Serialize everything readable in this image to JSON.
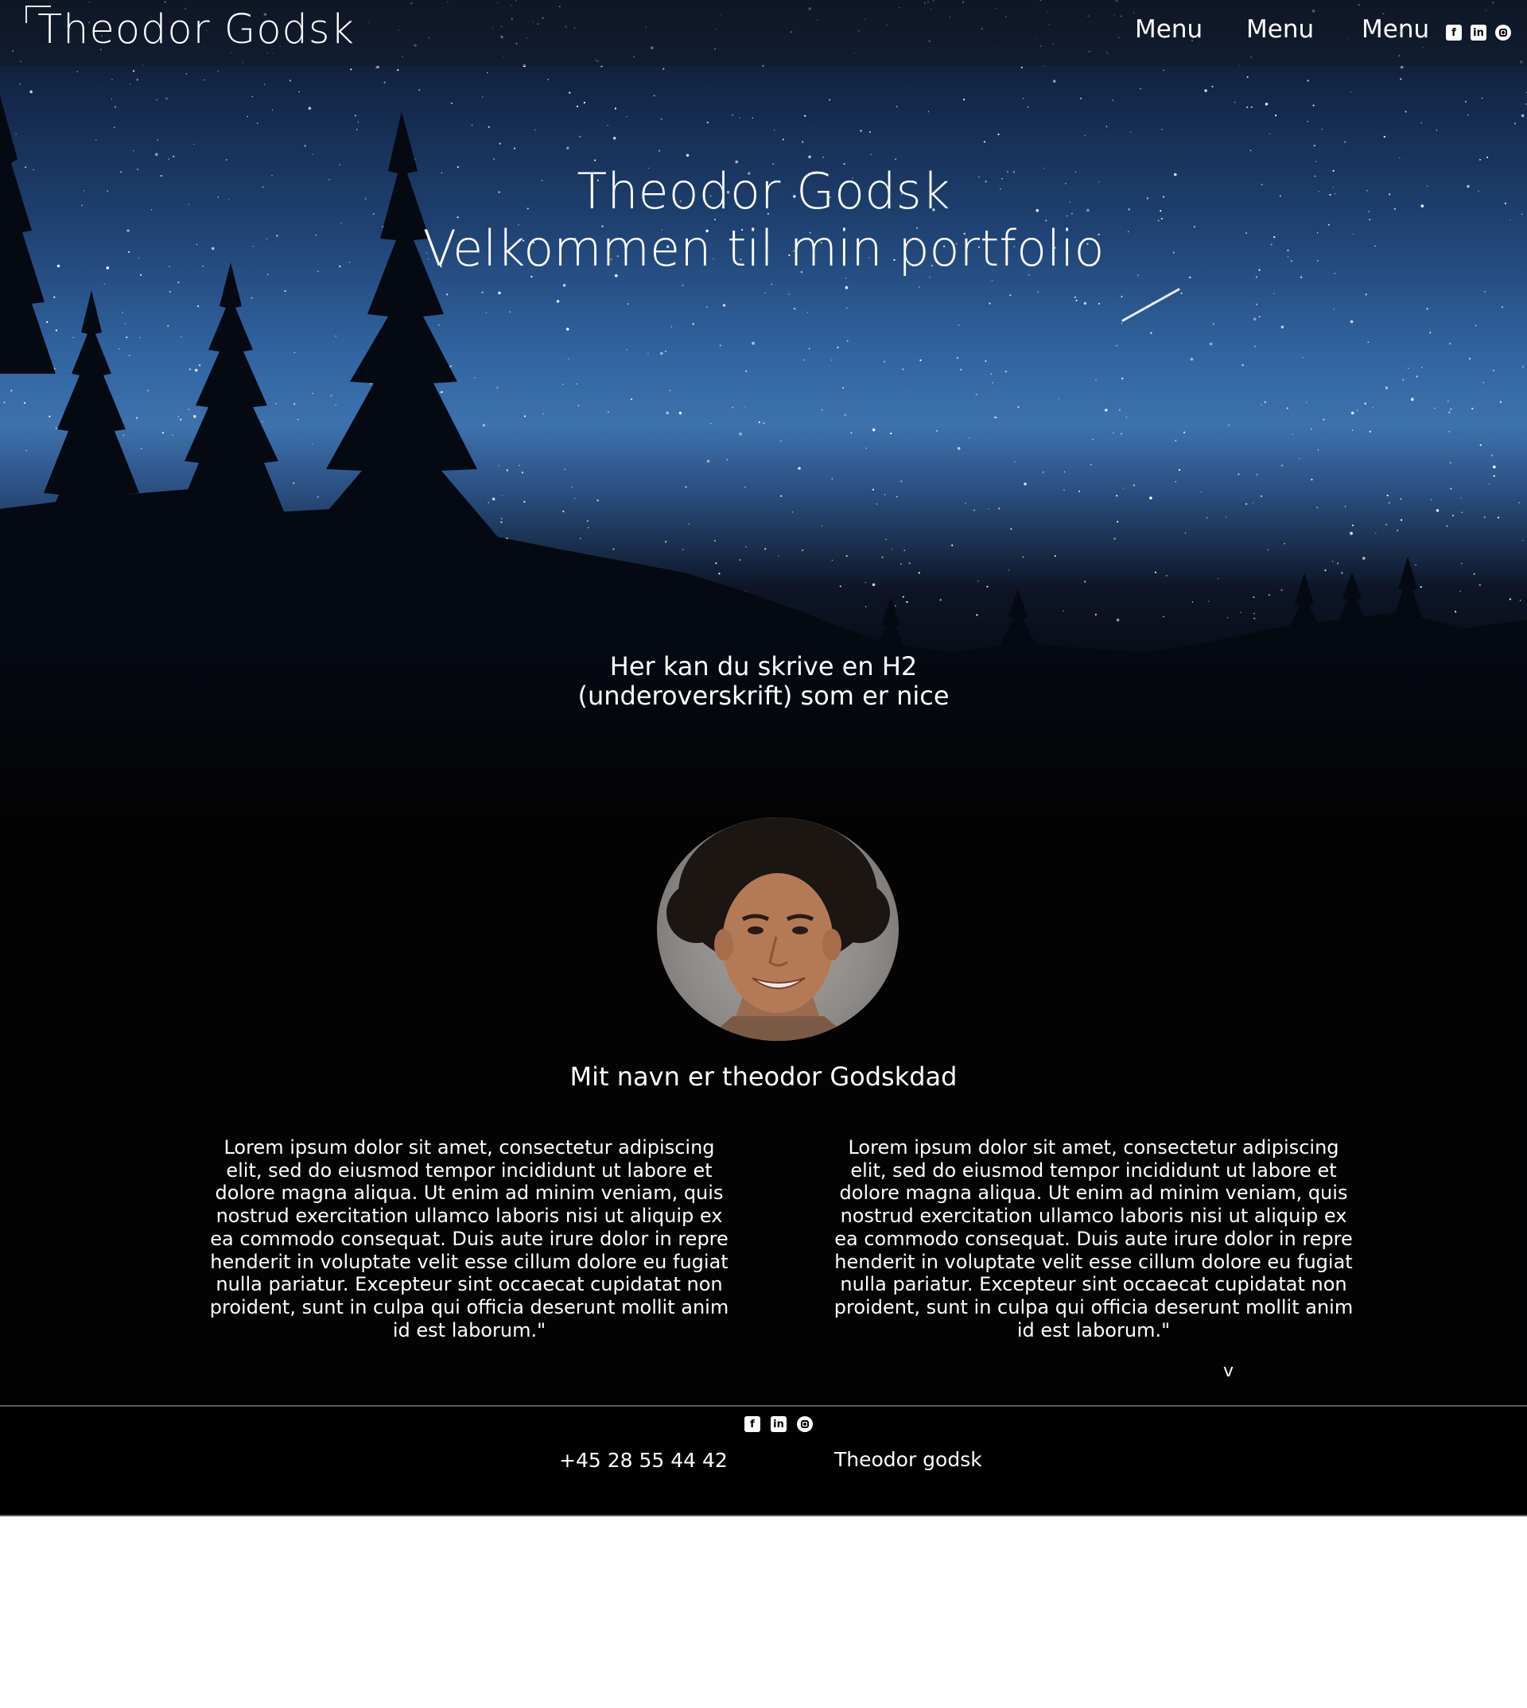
{
  "header": {
    "logo": "Theodor Godsk",
    "nav": [
      "Menu",
      "Menu",
      "Menu"
    ],
    "social_icons": [
      "facebook-icon",
      "linkedin-icon",
      "instagram-icon"
    ]
  },
  "hero": {
    "title_line1": "Theodor Godsk",
    "title_line2": "Velkommen til min portfolio",
    "subtitle_line1": "Her kan du skrive en H2",
    "subtitle_line2": "(underoverskrift) som er nice"
  },
  "about": {
    "heading": "Mit navn er theodor Godskdad",
    "paragraph_left": [
      "Lorem ipsum dolor sit amet, consectetur adipiscing",
      "elit, sed do eiusmod tempor incididunt ut labore et",
      "dolore magna aliqua. Ut enim ad minim veniam, quis",
      "nostrud exercitation ullamco laboris nisi ut aliquip ex",
      "ea commodo consequat. Duis aute irure dolor in repre",
      "henderit in voluptate velit esse cillum dolore eu fugiat",
      "nulla pariatur. Excepteur sint occaecat cupidatat non",
      "proident, sunt in culpa qui officia deserunt mollit anim",
      "id est laborum.\""
    ],
    "paragraph_right": [
      "Lorem ipsum dolor sit amet, consectetur adipiscing",
      "elit, sed do eiusmod tempor incididunt ut labore et",
      "dolore magna aliqua. Ut enim ad minim veniam, quis",
      "nostrud exercitation ullamco laboris nisi ut aliquip ex",
      "ea commodo consequat. Duis aute irure dolor in repre",
      "henderit in voluptate velit esse cillum dolore eu fugiat",
      "nulla pariatur. Excepteur sint occaecat cupidatat non",
      "proident, sunt in culpa qui officia deserunt mollit anim",
      "id est laborum.\""
    ],
    "scroll_marker": "v"
  },
  "footer": {
    "social_icons": [
      "facebook-icon",
      "linkedin-icon",
      "instagram-icon"
    ],
    "phone": "+45 28 55 44 42",
    "name": "Theodor godsk"
  },
  "colors": {
    "background": "#030303",
    "text": "#ffffff",
    "sky_accent": "#3d72ad",
    "page_bottom": "#ffffff"
  }
}
